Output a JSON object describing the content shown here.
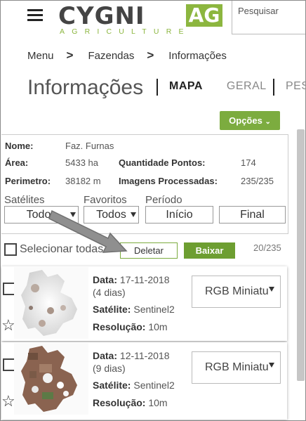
{
  "header": {
    "logo_main": "CYGNI",
    "logo_ag": "AG",
    "logo_sub": "AGRICULTURE",
    "search_placeholder": "Pesquisar"
  },
  "breadcrumb": {
    "items": [
      "Menu",
      "Fazendas",
      "Informações"
    ],
    "separator": ">"
  },
  "page_title": "Informações",
  "tabs": [
    {
      "label": "MAPA",
      "active": true
    },
    {
      "label": "GERAL",
      "active": false
    },
    {
      "label": "PES",
      "active": false
    }
  ],
  "options_button": "Opções",
  "info": {
    "nome_label": "Nome:",
    "nome_value": "Faz. Furnas",
    "area_label": "Área:",
    "area_value": "5433 ha",
    "qtd_label": "Quantidade Pontos:",
    "qtd_value": "174",
    "perim_label": "Perimetro:",
    "perim_value": "38182 m",
    "imgs_label": "Imagens Processadas:",
    "imgs_value": "235/235"
  },
  "filters": {
    "satelites_label": "Satélites",
    "satelites_value": "Todos",
    "favoritos_label": "Favoritos",
    "favoritos_value": "Todos",
    "periodo_label": "Período",
    "inicio": "Início",
    "final": "Final"
  },
  "selection": {
    "select_all": "Selecionar todas",
    "delete_button": "Deletar",
    "download_button": "Baixar",
    "count": "20/235"
  },
  "images": [
    {
      "data_label": "Data:",
      "date": "17-11-2018",
      "days": "(4 dias)",
      "sat_label": "Satélite:",
      "satellite": "Sentinel2",
      "res_label": "Resolução:",
      "resolution": "10m",
      "view": "RGB Miniatu"
    },
    {
      "data_label": "Data:",
      "date": "12-11-2018",
      "days": "(9 dias)",
      "sat_label": "Satélite:",
      "satellite": "Sentinel2",
      "res_label": "Resolução:",
      "resolution": "10m",
      "view": "RGB Miniatu"
    }
  ],
  "colors": {
    "brand_green": "#8cb63f",
    "button_green": "#6d9e31"
  },
  "icons": [
    "menu-icon",
    "chevron-right-icon",
    "caret-down-icon",
    "star-outline-icon",
    "arrow-annotation"
  ]
}
